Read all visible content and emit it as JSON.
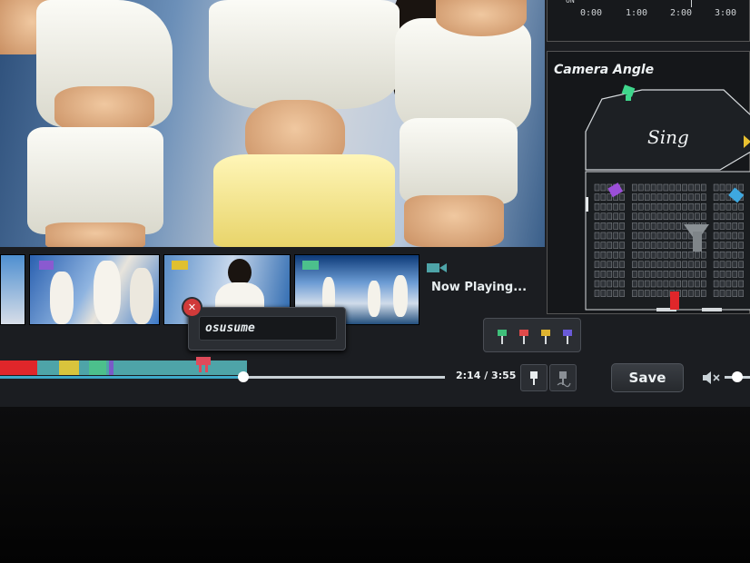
{
  "timecodes": [
    "0:00",
    "1:00",
    "2:00",
    "3:00"
  ],
  "timecode_partial": "ON",
  "camera_panel": {
    "title": "Camera Angle",
    "stage_logo": "Sing"
  },
  "now_playing": {
    "label": "Now Playing..."
  },
  "caption": {
    "value": "osusume"
  },
  "playback": {
    "time_label": "2:14 / 3:55",
    "progress": 0.547
  },
  "save_button": {
    "label": "Save"
  },
  "volume": {
    "level": 0.5
  },
  "pin_colors": [
    "#3fbf7a",
    "#e04a4a",
    "#e0b430",
    "#6a5ad8"
  ],
  "marker_segments": [
    {
      "color": "#e0262a",
      "start": 0.0,
      "end": 0.15
    },
    {
      "color": "#4ea4a8",
      "start": 0.15,
      "end": 0.2
    },
    {
      "color": "#d9c43c",
      "start": 0.24,
      "end": 0.32
    },
    {
      "color": "#4cc08c",
      "start": 0.36,
      "end": 0.43
    },
    {
      "color": "#7a5ac8",
      "start": 0.44,
      "end": 0.46
    }
  ],
  "colors": {
    "accent": "#3ea8c8",
    "panel": "#2b2e33"
  }
}
